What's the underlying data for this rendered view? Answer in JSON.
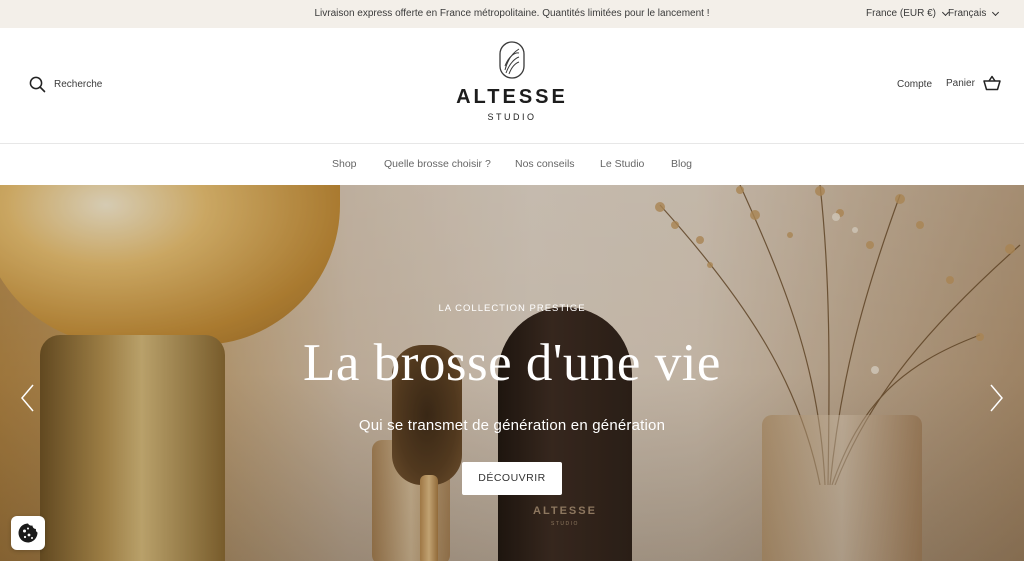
{
  "announcement": {
    "message": "Livraison express offerte en France métropolitaine. Quantités limitées pour le lancement !",
    "country": "France (EUR €)",
    "language": "Français"
  },
  "header": {
    "search_label": "Recherche",
    "logo_brand": "ALTESSE",
    "logo_sub": "STUDIO",
    "account_label": "Compte",
    "cart_label": "Panier"
  },
  "nav": {
    "items": [
      "Shop",
      "Quelle brosse choisir ?",
      "Nos conseils",
      "Le Studio",
      "Blog"
    ]
  },
  "hero": {
    "kicker": "LA COLLECTION PRESTIGE",
    "title": "La brosse d'une vie",
    "subtitle": "Qui se transmet de génération en génération",
    "button_label": "DÉCOUVRIR",
    "product_brand": "ALTESSE",
    "product_sub": "STUDIO"
  },
  "icons": {
    "search": "search-icon",
    "cart": "basket-icon",
    "logo": "logo-emblem-icon",
    "prev": "chevron-left-icon",
    "next": "chevron-right-icon",
    "cookie": "cookie-icon",
    "dropdown": "chevron-down-icon"
  }
}
